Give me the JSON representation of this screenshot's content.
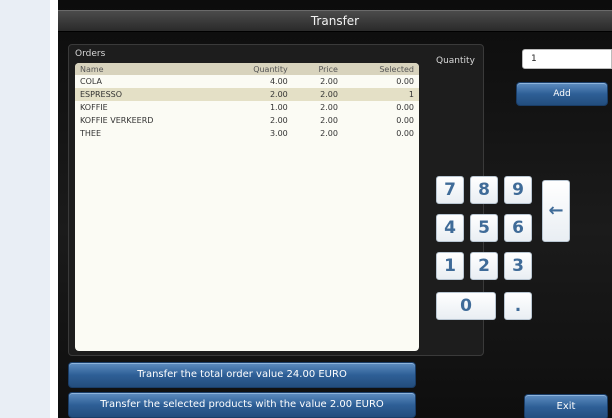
{
  "window": {
    "title": "Transfer"
  },
  "orders": {
    "label": "Orders",
    "columns": [
      "Name",
      "Quantity",
      "Price",
      "Selected"
    ],
    "rows": [
      {
        "name": "COLA",
        "quantity": "4.00",
        "price": "2.00",
        "selected": "0.00"
      },
      {
        "name": "ESPRESSO",
        "quantity": "2.00",
        "price": "2.00",
        "selected": "1"
      },
      {
        "name": "KOFFIE",
        "quantity": "1.00",
        "price": "2.00",
        "selected": "0.00"
      },
      {
        "name": "KOFFIE VERKEERD",
        "quantity": "2.00",
        "price": "2.00",
        "selected": "0.00"
      },
      {
        "name": "THEE",
        "quantity": "3.00",
        "price": "2.00",
        "selected": "0.00"
      }
    ],
    "highlighted_row": 1
  },
  "quantity": {
    "label": "Quantity",
    "value": "1"
  },
  "add_button": {
    "label": "Add"
  },
  "keypad": {
    "keys": [
      "7",
      "8",
      "9",
      "4",
      "5",
      "6",
      "1",
      "2",
      "3",
      "0",
      "."
    ],
    "backspace": "←"
  },
  "bottom": {
    "transfer_total_label": "Transfer the total order value 24.00 EURO",
    "transfer_selected_label": "Transfer the selected products with the value 2.00 EURO",
    "exit_label": "Exit"
  },
  "colors": {
    "accent_button": "#2e5f96",
    "keypad_text": "#3f6b98",
    "table_header": "#d8d3bd",
    "table_selected_row": "#e4e0c6"
  }
}
